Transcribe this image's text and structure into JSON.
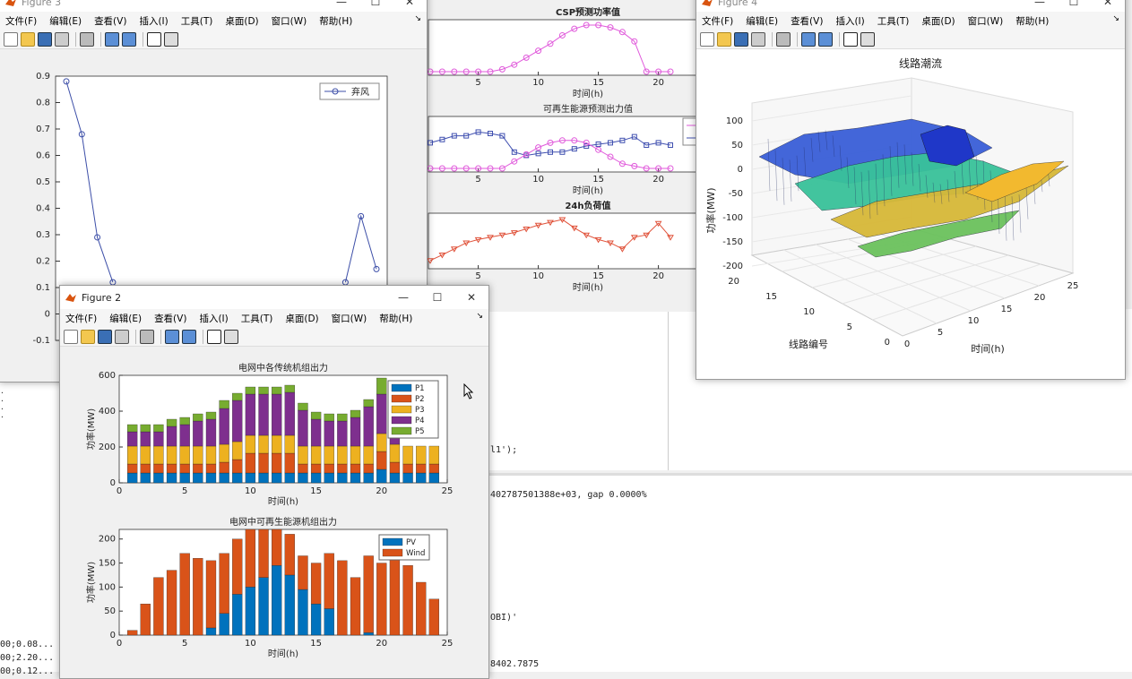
{
  "menus": [
    "文件(F)",
    "编辑(E)",
    "查看(V)",
    "插入(I)",
    "工具(T)",
    "桌面(D)",
    "窗口(W)",
    "帮助(H)"
  ],
  "menus_short": [
    "文件(F)",
    "编辑(E)",
    "查看(V)",
    "插入(I)",
    "工具(T)",
    "桌面(D)",
    "窗口(W)",
    "帮助(H)"
  ],
  "console": {
    "line1": "l1');",
    "line2": "402787501388e+03, gap 0.0000%",
    "line3": "OBI)'",
    "line4": "8402.7875",
    "left1": "00;0.08...",
    "left2": "00;2.20...",
    "left3": "00;0.12..."
  },
  "fig3": {
    "title": "Figure 3",
    "chart_data": {
      "type": "line",
      "x": [
        1,
        2,
        3,
        4,
        19,
        20,
        21
      ],
      "series": [
        {
          "name": "弃风",
          "values": [
            0.88,
            0.68,
            0.29,
            0.12,
            0.12,
            0.37,
            0.17
          ]
        }
      ],
      "ylim": [
        -0.1,
        0.9
      ],
      "yticks": [
        "0.9",
        "0.8",
        "0.7",
        "0.6",
        "0.5",
        "0.4",
        "0.3",
        "0.2",
        "0.1",
        "0",
        "-0.1"
      ],
      "legend": "弃风"
    }
  },
  "figmid": {
    "chart_data": [
      {
        "type": "line",
        "title": "CSP预测功率值",
        "xlabel": "时间(h)",
        "x": [
          1,
          2,
          3,
          4,
          5,
          6,
          7,
          8,
          9,
          10,
          11,
          12,
          13,
          14,
          15,
          16,
          17,
          18,
          19,
          20,
          21
        ],
        "series": [
          {
            "values": [
              0,
              0,
              0,
              0,
              0,
              0,
              0.05,
              0.15,
              0.3,
              0.45,
              0.6,
              0.78,
              0.92,
              1.0,
              1.0,
              0.95,
              0.85,
              0.65,
              0.0,
              0.0,
              0.0
            ]
          }
        ],
        "xticks": [
          "5",
          "10",
          "15",
          "20"
        ]
      },
      {
        "type": "line",
        "title": "可再生能源预测出力值",
        "xlabel": "时间(h)",
        "x": [
          1,
          2,
          3,
          4,
          5,
          6,
          7,
          8,
          9,
          10,
          11,
          12,
          13,
          14,
          15,
          16,
          17,
          18,
          19,
          20,
          21
        ],
        "series": [
          {
            "values": [
              0.55,
              0.62,
              0.7,
              0.7,
              0.78,
              0.75,
              0.7,
              0.35,
              0.28,
              0.32,
              0.35,
              0.35,
              0.42,
              0.48,
              0.52,
              0.55,
              0.6,
              0.68,
              0.5,
              0.55,
              0.5
            ]
          },
          {
            "values": [
              0,
              0,
              0,
              0,
              0,
              0,
              0,
              0.15,
              0.3,
              0.45,
              0.55,
              0.6,
              0.6,
              0.55,
              0.4,
              0.25,
              0.1,
              0.05,
              0,
              0,
              0
            ]
          }
        ],
        "xticks": [
          "5",
          "10",
          "15",
          "20"
        ]
      },
      {
        "type": "line",
        "title": "24h负荷值",
        "xlabel": "时间(h)",
        "x": [
          1,
          2,
          3,
          4,
          5,
          6,
          7,
          8,
          9,
          10,
          11,
          12,
          13,
          14,
          15,
          16,
          17,
          18,
          19,
          20,
          21
        ],
        "series": [
          {
            "values": [
              0.1,
              0.22,
              0.35,
              0.48,
              0.55,
              0.6,
              0.65,
              0.7,
              0.78,
              0.86,
              0.92,
              0.98,
              0.8,
              0.65,
              0.55,
              0.48,
              0.35,
              0.6,
              0.65,
              0.9,
              0.6
            ]
          }
        ],
        "xticks": [
          "5",
          "10",
          "15",
          "20"
        ]
      }
    ]
  },
  "fig4": {
    "title": "Figure 4",
    "chart_data": {
      "type": "surface",
      "title": "线路潮流",
      "zlabel": "功率(MW)",
      "xlabel": "时间(h)",
      "ylabel": "线路编号",
      "zticks": [
        "100",
        "50",
        "0",
        "-50",
        "-100",
        "-150",
        "-200"
      ],
      "xticks": [
        "0",
        "5",
        "10",
        "15",
        "20",
        "25"
      ],
      "yticks": [
        "20",
        "15",
        "10",
        "5",
        "0"
      ]
    }
  },
  "fig2": {
    "title": "Figure 2",
    "chart_top": {
      "type": "bar",
      "title": "电网中各传统机组出力",
      "xlabel": "时间(h)",
      "ylabel": "功率(MW)",
      "ylim": [
        0,
        600
      ],
      "yticks": [
        "600",
        "400",
        "200",
        "0"
      ],
      "xticks": [
        "0",
        "5",
        "10",
        "15",
        "20",
        "25"
      ],
      "categories": [
        1,
        2,
        3,
        4,
        5,
        6,
        7,
        8,
        9,
        10,
        11,
        12,
        13,
        14,
        15,
        16,
        17,
        18,
        19,
        20,
        21,
        22,
        23,
        24
      ],
      "series": [
        {
          "name": "P1",
          "color": "#0072bd",
          "values": [
            55,
            55,
            55,
            55,
            55,
            55,
            55,
            55,
            55,
            55,
            55,
            55,
            55,
            55,
            55,
            55,
            55,
            55,
            55,
            75,
            55,
            55,
            55,
            55
          ]
        },
        {
          "name": "P2",
          "color": "#d95319",
          "values": [
            50,
            50,
            50,
            50,
            50,
            50,
            50,
            60,
            75,
            110,
            110,
            110,
            110,
            50,
            50,
            50,
            50,
            50,
            50,
            100,
            60,
            50,
            50,
            50
          ]
        },
        {
          "name": "P3",
          "color": "#edb120",
          "values": [
            100,
            100,
            100,
            100,
            100,
            100,
            100,
            100,
            100,
            100,
            100,
            100,
            100,
            100,
            100,
            100,
            100,
            100,
            100,
            100,
            100,
            100,
            100,
            100
          ]
        },
        {
          "name": "P4",
          "color": "#7e2f8e",
          "values": [
            80,
            80,
            80,
            110,
            120,
            140,
            150,
            200,
            230,
            230,
            230,
            230,
            240,
            200,
            150,
            140,
            140,
            160,
            220,
            220,
            190,
            0,
            0,
            0
          ]
        },
        {
          "name": "P5",
          "color": "#77ac30",
          "values": [
            40,
            40,
            40,
            40,
            40,
            40,
            40,
            45,
            40,
            40,
            40,
            40,
            40,
            40,
            40,
            40,
            40,
            40,
            40,
            90,
            40,
            0,
            0,
            0
          ]
        }
      ],
      "legend": [
        "P1",
        "P2",
        "P3",
        "P4",
        "P5"
      ]
    },
    "chart_bottom": {
      "type": "bar",
      "title": "电网中可再生能源机组出力",
      "xlabel": "时间(h)",
      "ylabel": "功率(MW)",
      "ylim": [
        0,
        220
      ],
      "yticks": [
        "200",
        "150",
        "100",
        "50",
        "0"
      ],
      "xticks": [
        "0",
        "5",
        "10",
        "15",
        "20",
        "25"
      ],
      "categories": [
        1,
        2,
        3,
        4,
        5,
        6,
        7,
        8,
        9,
        10,
        11,
        12,
        13,
        14,
        15,
        16,
        17,
        18,
        19,
        20,
        21,
        22,
        23,
        24
      ],
      "series": [
        {
          "name": "PV",
          "color": "#0072bd",
          "values": [
            0,
            0,
            0,
            0,
            0,
            0,
            15,
            45,
            85,
            100,
            120,
            145,
            125,
            95,
            65,
            55,
            0,
            0,
            5,
            0,
            0,
            0,
            0,
            0
          ]
        },
        {
          "name": "Wind",
          "color": "#d95319",
          "values": [
            10,
            65,
            120,
            135,
            170,
            160,
            140,
            125,
            115,
            170,
            160,
            80,
            85,
            70,
            85,
            115,
            155,
            120,
            160,
            150,
            160,
            145,
            110,
            75
          ]
        }
      ],
      "legend": [
        "PV",
        "Wind"
      ]
    }
  }
}
